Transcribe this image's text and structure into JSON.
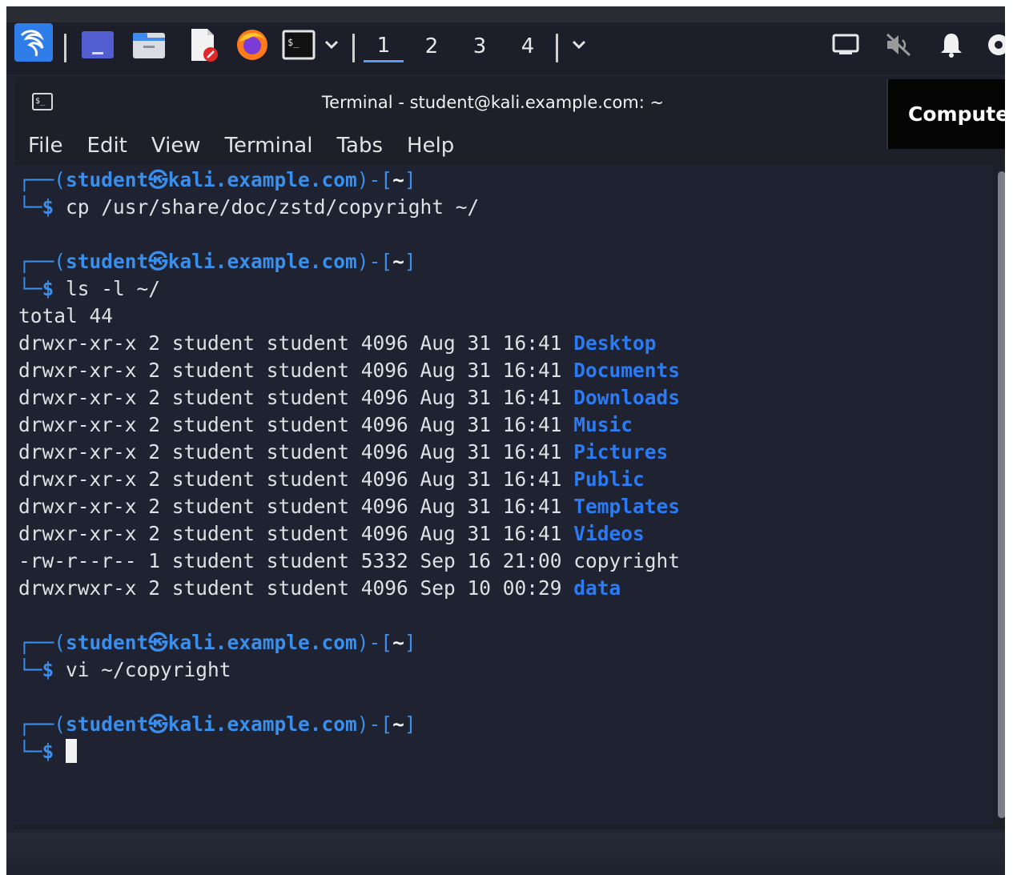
{
  "taskbar": {
    "apps": [
      {
        "icon": "kali-dragon-icon"
      },
      {
        "icon": "show-desktop-icon"
      },
      {
        "icon": "file-manager-icon"
      },
      {
        "icon": "text-editor-icon"
      },
      {
        "icon": "firefox-icon"
      },
      {
        "icon": "terminal-icon"
      }
    ],
    "workspaces": [
      "1",
      "2",
      "3",
      "4"
    ],
    "active_workspace": "1",
    "tray": [
      "network-icon",
      "volume-muted-icon",
      "notification-bell-icon",
      "power-icon"
    ]
  },
  "window": {
    "title": "Terminal - student@kali.example.com: ~",
    "menu": [
      "File",
      "Edit",
      "View",
      "Terminal",
      "Tabs",
      "Help"
    ]
  },
  "tooltip": "Computer",
  "terminal": {
    "prompt_user": "student",
    "prompt_symbol": "㉿",
    "prompt_host": "kali.example.com",
    "prompt_dir": "~",
    "commands": [
      "cp /usr/share/doc/zstd/copyright ~/",
      "ls -l ~/",
      "vi ~/copyright",
      ""
    ],
    "ls_total": "total 44",
    "ls_entries": [
      {
        "meta": "drwxr-xr-x 2 student student 4096 Aug 31 16:41 ",
        "name": "Desktop",
        "is_dir": true
      },
      {
        "meta": "drwxr-xr-x 2 student student 4096 Aug 31 16:41 ",
        "name": "Documents",
        "is_dir": true
      },
      {
        "meta": "drwxr-xr-x 2 student student 4096 Aug 31 16:41 ",
        "name": "Downloads",
        "is_dir": true
      },
      {
        "meta": "drwxr-xr-x 2 student student 4096 Aug 31 16:41 ",
        "name": "Music",
        "is_dir": true
      },
      {
        "meta": "drwxr-xr-x 2 student student 4096 Aug 31 16:41 ",
        "name": "Pictures",
        "is_dir": true
      },
      {
        "meta": "drwxr-xr-x 2 student student 4096 Aug 31 16:41 ",
        "name": "Public",
        "is_dir": true
      },
      {
        "meta": "drwxr-xr-x 2 student student 4096 Aug 31 16:41 ",
        "name": "Templates",
        "is_dir": true
      },
      {
        "meta": "drwxr-xr-x 2 student student 4096 Aug 31 16:41 ",
        "name": "Videos",
        "is_dir": true
      },
      {
        "meta": "-rw-r--r-- 1 student student 5332 Sep 16 21:00 ",
        "name": "copyright",
        "is_dir": false
      },
      {
        "meta": "drwxrwxr-x 2 student student 4096 Sep 10 00:29 ",
        "name": "data",
        "is_dir": true
      }
    ]
  }
}
